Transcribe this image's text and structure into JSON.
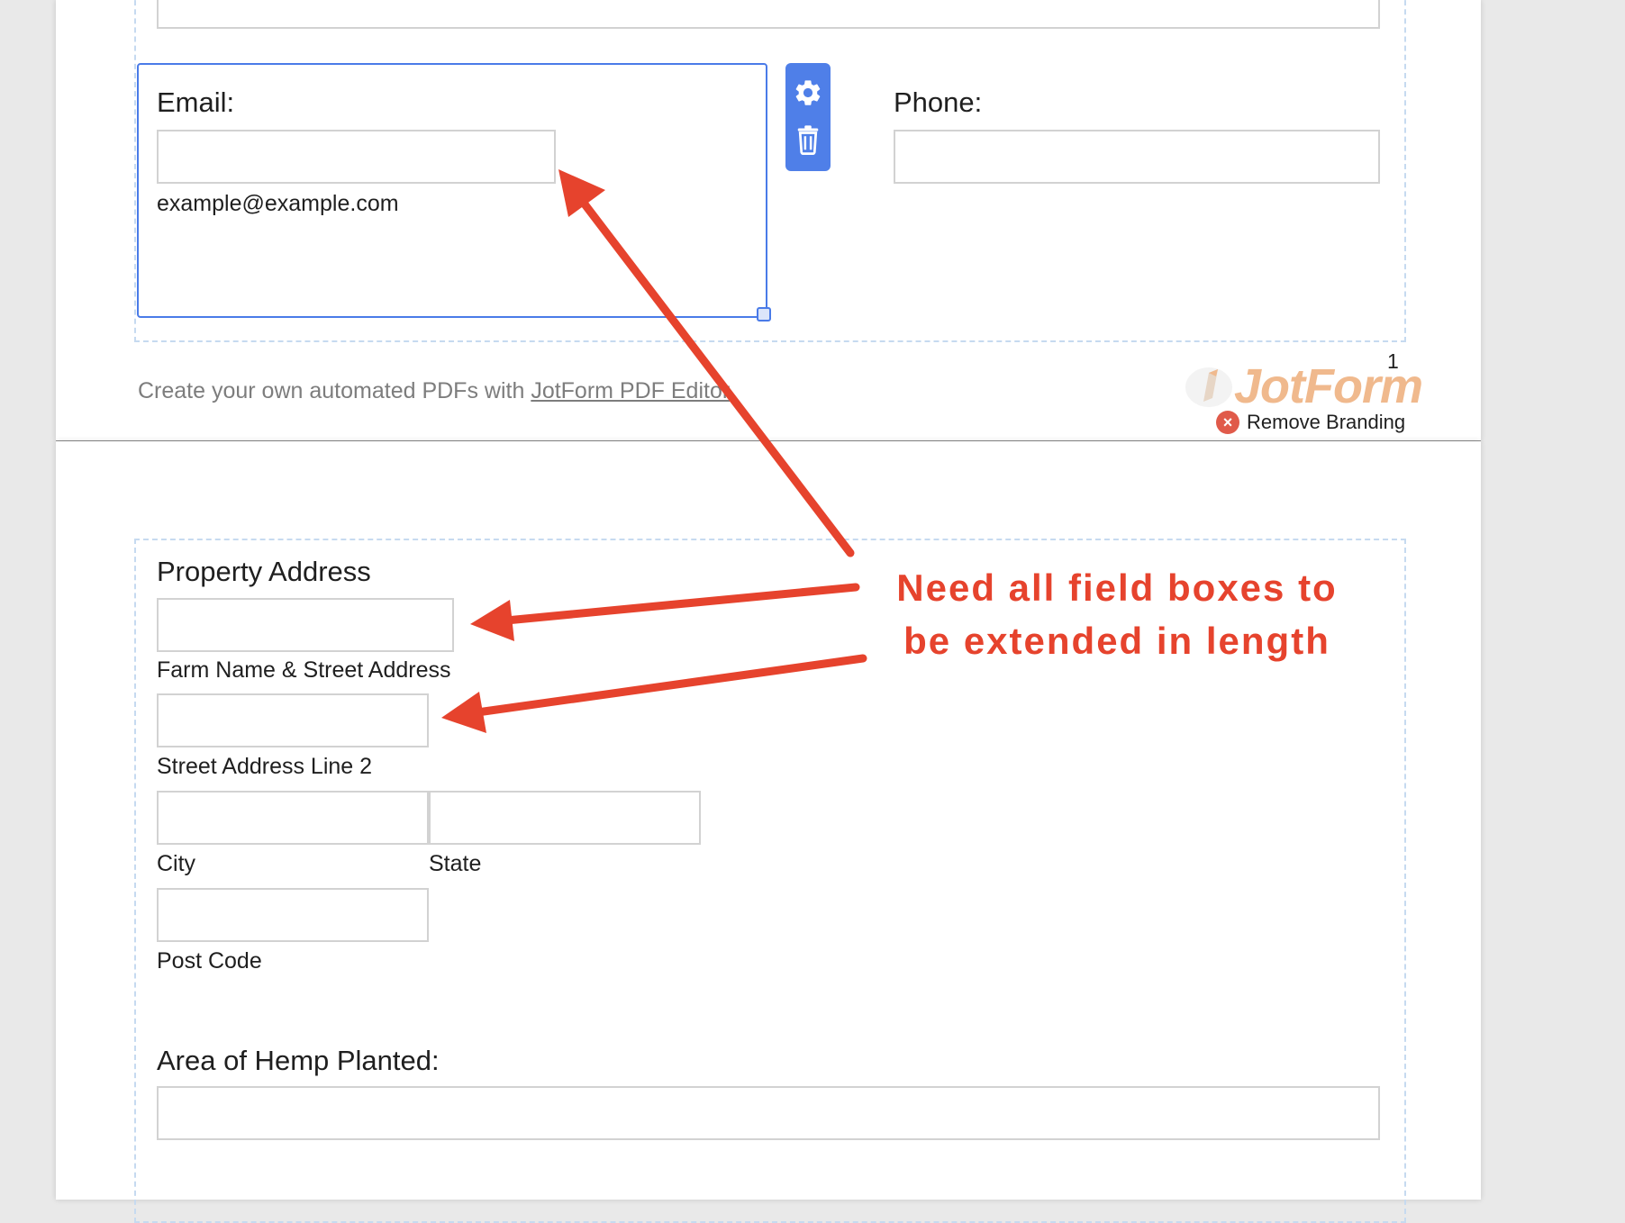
{
  "contact_fields": {
    "email_label": "Email:",
    "email_value": "",
    "email_sublabel": "example@example.com",
    "phone_label": "Phone:",
    "phone_value": ""
  },
  "toolbar": {
    "settings_icon": "gear-icon",
    "delete_icon": "trash-icon"
  },
  "footer": {
    "prefix_text": "Create your own automated PDFs with ",
    "link_text": "JotForm PDF Editor",
    "page_number": "1",
    "brand_wordmark": "JotForm",
    "remove_branding_label": "Remove Branding"
  },
  "property_address": {
    "heading": "Property Address",
    "street_line1_sublabel": "Farm Name & Street Address",
    "street_line2_sublabel": "Street Address Line 2",
    "city_sublabel": "City",
    "state_sublabel": "State",
    "post_code_sublabel": "Post Code"
  },
  "hemp_area": {
    "label": "Area of Hemp Planted:"
  },
  "annotation": {
    "line1": "Need all field boxes to",
    "line2": "be extended in length"
  },
  "colors": {
    "annotation_red": "#e6432d",
    "selection_blue": "#4a7be8",
    "toolbar_blue": "#4f7fe8",
    "dashed_section": "#c6daf0",
    "brand_orange": "#f0b98d"
  }
}
